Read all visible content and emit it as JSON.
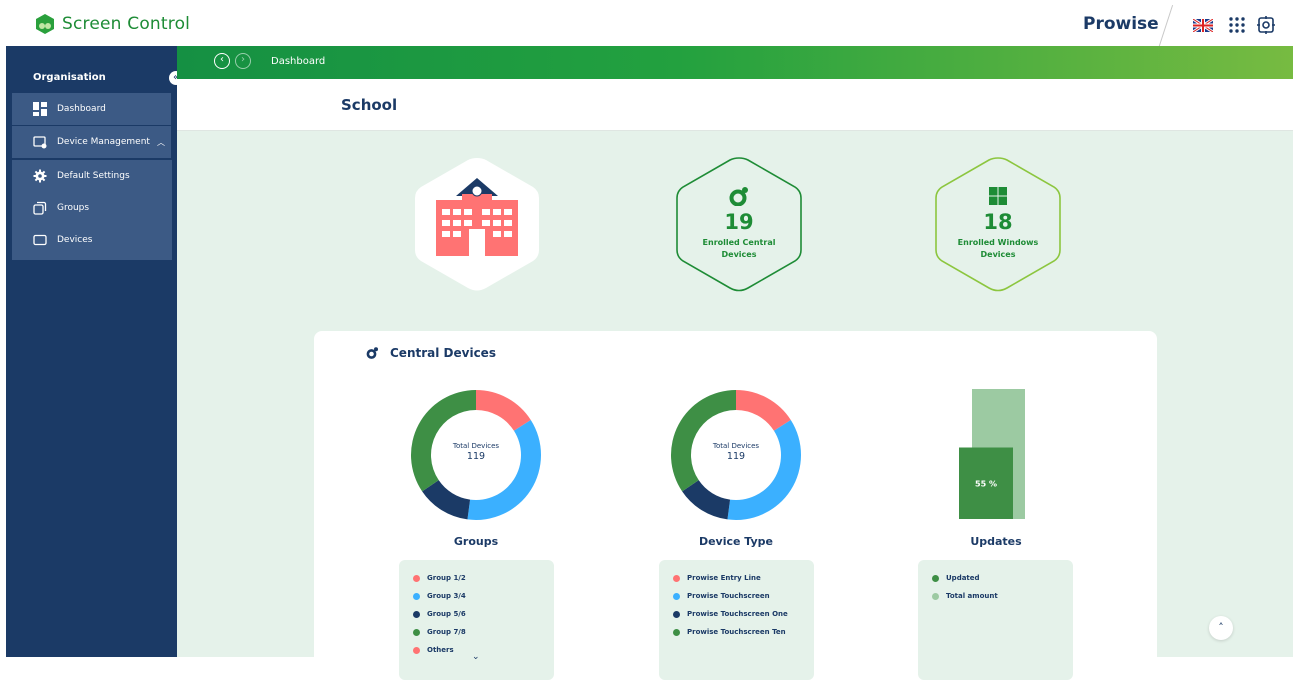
{
  "app": {
    "name": "Screen Control",
    "brand": "Prowise"
  },
  "header_icons": [
    "uk-flag-icon",
    "apps-grid-icon",
    "settings-icon"
  ],
  "sidebar": {
    "section_title": "Organisation",
    "items": [
      {
        "label": "Dashboard",
        "icon": "dashboard-icon"
      },
      {
        "label": "Device Management",
        "icon": "device-settings-icon"
      }
    ],
    "subitems": [
      {
        "label": "Default Settings",
        "icon": "gear-icon"
      },
      {
        "label": "Groups",
        "icon": "groups-icon"
      },
      {
        "label": "Devices",
        "icon": "device-icon"
      }
    ]
  },
  "breadcrumb": {
    "current": "Dashboard"
  },
  "page": {
    "title": "School"
  },
  "stats": [
    {
      "value": "19",
      "label_line1": "Enrolled Central",
      "label_line2": "Devices",
      "icon": "central-icon"
    },
    {
      "value": "18",
      "label_line1": "Enrolled Windows",
      "label_line2": "Devices",
      "icon": "windows-icon"
    }
  ],
  "card": {
    "title": "Central Devices"
  },
  "colors": {
    "pink": "#ff7373",
    "light_blue": "#3bb0ff",
    "navy": "#1b3a66",
    "green": "#3e8f45",
    "light_green": "#9ccaa2",
    "accent_green": "#1e8c36"
  },
  "chart_data": [
    {
      "type": "pie",
      "title": "Groups",
      "center_label": "Total Devices",
      "center_value": "119",
      "categories": [
        "Group 1/2",
        "Group 3/4",
        "Group 5/6",
        "Group 7/8",
        "Others"
      ],
      "values": [
        19,
        43,
        16,
        41,
        0
      ],
      "colors": [
        "#ff7373",
        "#3bb0ff",
        "#1b3a66",
        "#3e8f45",
        "#ff7373"
      ]
    },
    {
      "type": "pie",
      "title": "Device Type",
      "center_label": "Total Devices",
      "center_value": "119",
      "categories": [
        "Prowise Entry Line",
        "Prowise Touchscreen",
        "Prowise Touchscreen One",
        "Prowise Touchscreen Ten"
      ],
      "values": [
        19,
        43,
        16,
        41
      ],
      "colors": [
        "#ff7373",
        "#3bb0ff",
        "#1b3a66",
        "#3e8f45"
      ]
    },
    {
      "type": "bar",
      "title": "Updates",
      "categories": [
        "Updated",
        "Total amount"
      ],
      "values": [
        55,
        100
      ],
      "value_label": "55 %",
      "ylim": [
        0,
        100
      ],
      "colors": [
        "#3e8f45",
        "#9ccaa2"
      ]
    }
  ]
}
